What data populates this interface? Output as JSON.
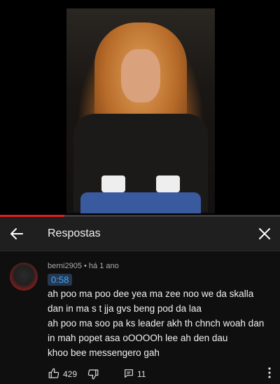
{
  "video": {
    "progress_fraction": 0.23
  },
  "header": {
    "title": "Respostas"
  },
  "comment": {
    "author": "berni2905",
    "meta": " • há 1 ano",
    "timestamp": "0:58",
    "lines": [
      "ah poo ma poo dee yea ma zee noo we da skalla",
      "dan in ma s t jja gvs beng pod da laa",
      "ah poo ma soo pa ks leader akh th chnch woah dan",
      "in mah popet asa oOOOOh lee ah den dau",
      "khoo bee messengero gah"
    ],
    "likes": "429",
    "replies": "11"
  },
  "colors": {
    "accent_red": "#e01e1e",
    "link_blue": "#3ea6ff"
  }
}
